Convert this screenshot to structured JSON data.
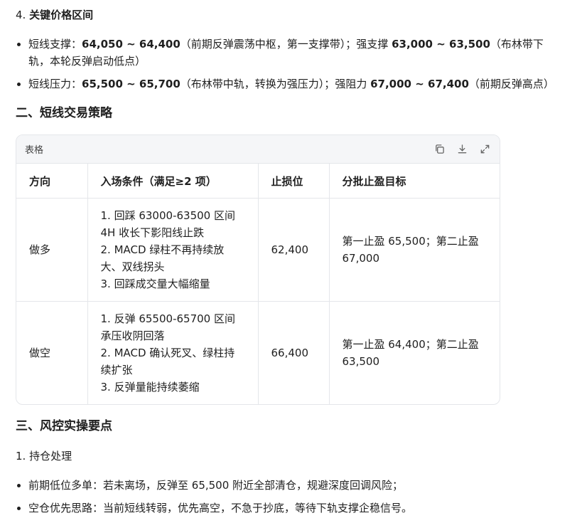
{
  "section4": {
    "number": "4.",
    "title": "关键价格区间",
    "bullets": [
      {
        "label": "短线支撑：",
        "v1": "64,050 ~ 64,400",
        "t1": "（前期反弹震荡中枢，第一支撑带）；",
        "label2": "强支撑",
        "v2": "63,000 ~ 63,500",
        "t2a": "（布林带下",
        "t2b": "轨，本轮反弹启动低点）"
      },
      {
        "label": "短线压力：",
        "v1": "65,500 ~ 65,700",
        "t1": "（布林带中轨，转换为强压力）；",
        "label2": "强阻力",
        "v2": "67,000 ~ 67,400",
        "t2": "（前期反弹高点）"
      }
    ]
  },
  "section2": {
    "title": "二、短线交易策略"
  },
  "table": {
    "card_title": "表格",
    "icons": [
      "copy-icon",
      "download-icon",
      "expand-icon"
    ],
    "headers": [
      "方向",
      "入场条件（满足≥2 项）",
      "止损位",
      "分批止盈目标"
    ],
    "rows": [
      {
        "direction": "做多",
        "conditions": [
          "1. 回踩 63000-63500 区间",
          "4H 收长下影阳线止跌",
          "2. MACD 绿柱不再持续放",
          "大、双线拐头",
          "3. 回踩成交量大幅缩量"
        ],
        "stop": "62,400",
        "targets": [
          "第一止盈 65,500；第二止盈",
          "67,000"
        ]
      },
      {
        "direction": "做空",
        "conditions": [
          "1. 反弹 65500-65700 区间",
          "承压收阴回落",
          "2. MACD 确认死叉、绿柱持",
          "续扩张",
          "3. 反弹量能持续萎缩"
        ],
        "stop": "66,400",
        "targets": [
          "第一止盈 64,400；第二止盈",
          "63,500"
        ]
      }
    ]
  },
  "section3": {
    "title": "三、风控实操要点",
    "sub": "1. 持仓处理",
    "bullets": [
      "前期低位多单：若未离场，反弹至 65,500 附近全部清仓，规避深度回调风险；",
      "空仓优先思路：当前短线转弱，优先高空，不急于抄底，等待下轨支撑企稳信号。"
    ]
  }
}
